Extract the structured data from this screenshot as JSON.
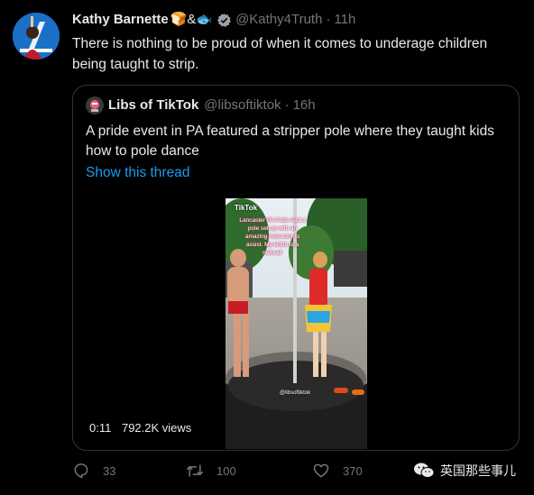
{
  "tweet": {
    "author_name": "Kathy Barnette",
    "author_emoji": "🍞&🐟",
    "author_handle": "@Kathy4Truth",
    "separator": "·",
    "time": "11h",
    "text": "There is nothing to be proud of when it comes to underage children being taught to strip."
  },
  "quote": {
    "author_name": "Libs of TikTok",
    "author_handle": "@libsoftiktok",
    "separator": "·",
    "time": "16h",
    "text": "A pride event in PA featured a stripper pole where they taught kids how to pole dance",
    "thread_link": "Show this thread",
    "video": {
      "tiktok_label": "TikTok",
      "overlay_text": "Lancaster PA Pride had a pole set up with an amazing instructor to assist. My kiddo is a natural!",
      "watermark": "@libsoftiktok",
      "duration": "0:11",
      "views": "792.2K views"
    }
  },
  "actions": {
    "replies": "33",
    "retweets": "100",
    "likes": "370"
  },
  "watermark": {
    "text": "英国那些事儿"
  },
  "colors": {
    "background": "#000000",
    "text": "#e7e9ea",
    "muted": "#71767b",
    "link": "#1d9bf0",
    "border": "#2f3336",
    "verified": "#9aa0a6"
  }
}
